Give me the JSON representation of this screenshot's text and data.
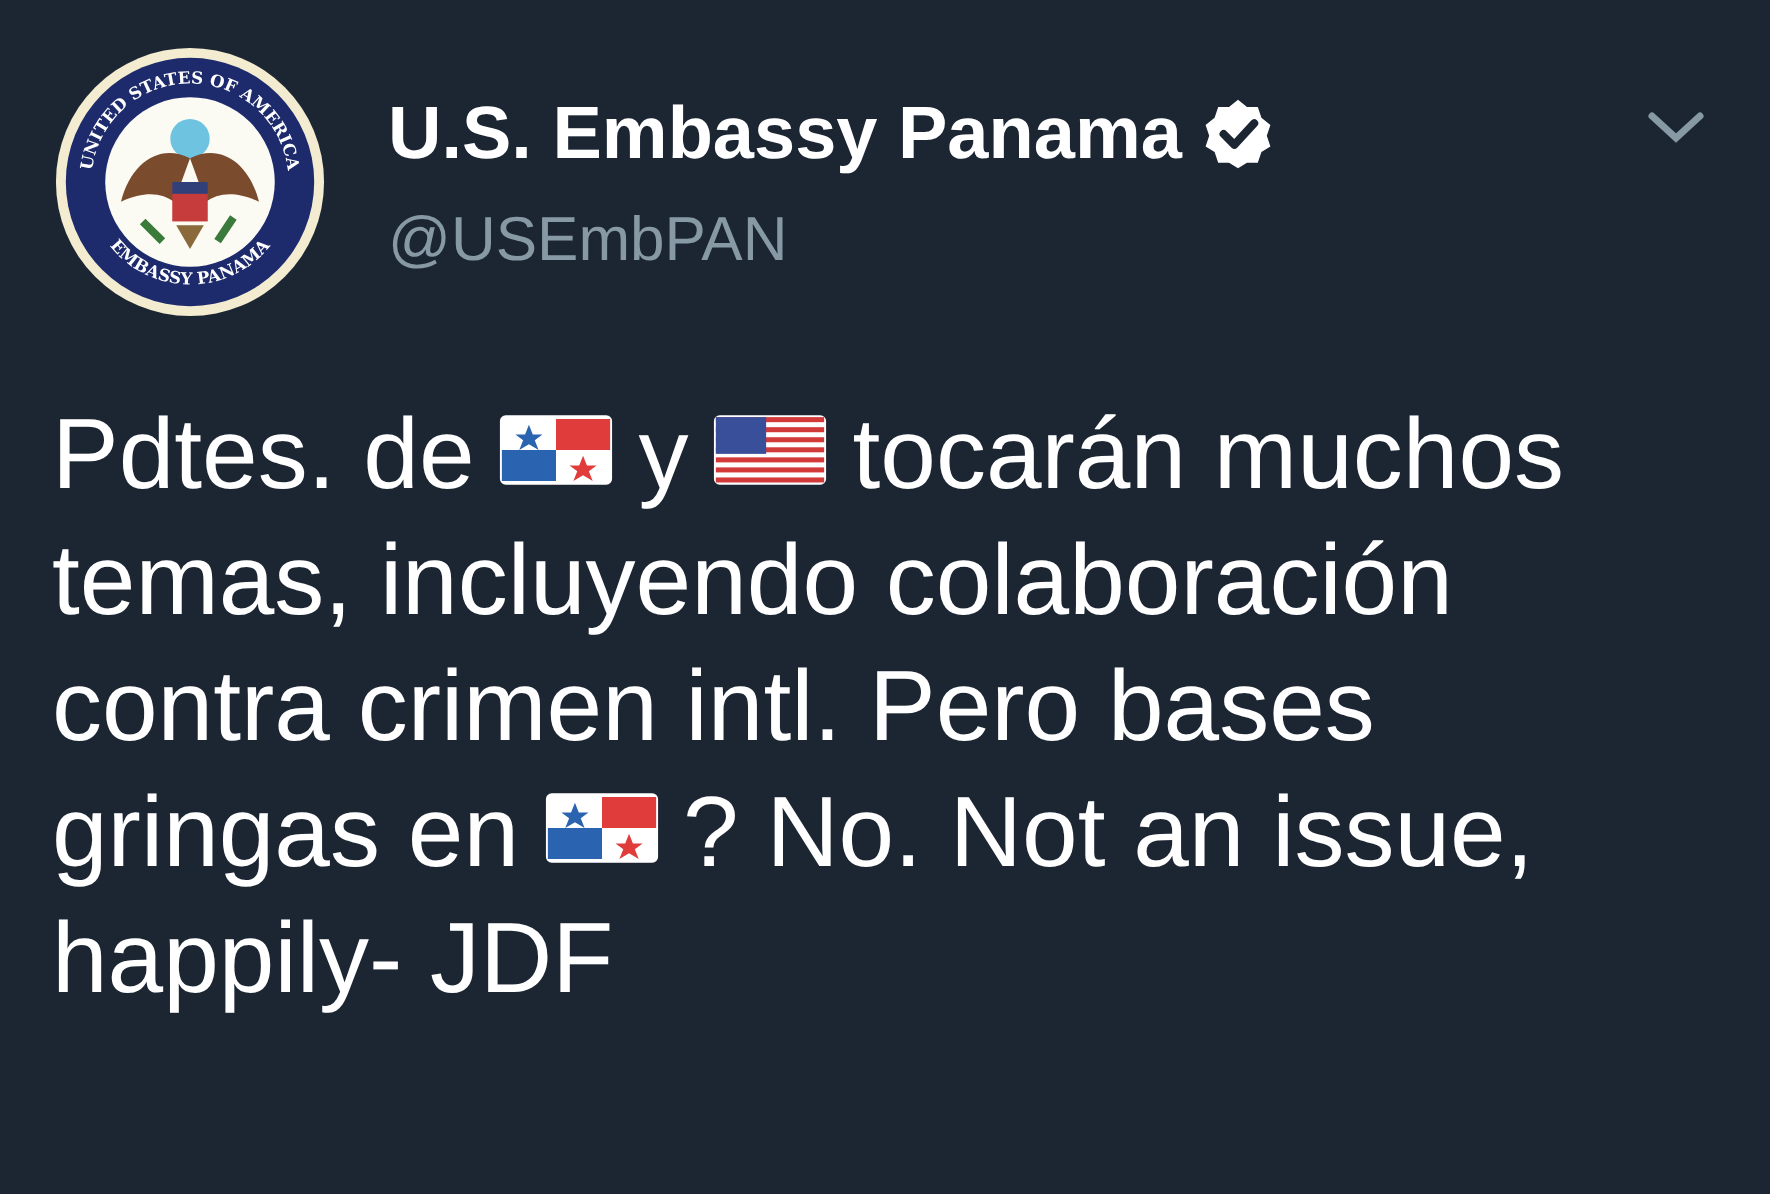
{
  "account": {
    "name": "U.S. Embassy Panama",
    "verified": true,
    "handle": "@USEmbPAN",
    "seal_top": "UNITED STATES OF AMERICA",
    "seal_bottom": "EMBASSY PANAMA"
  },
  "tweet_lines": [
    [
      {
        "kind": "text",
        "text": "Pdtes. de"
      },
      {
        "kind": "panama-flag"
      },
      {
        "kind": "text",
        "text": "y"
      },
      {
        "kind": "us-flag"
      },
      {
        "kind": "text",
        "text": "tocarán muchos"
      }
    ],
    [
      {
        "kind": "text",
        "text": "temas, incluyendo colaboración"
      }
    ],
    [
      {
        "kind": "text",
        "text": "contra crimen intl. Pero bases"
      }
    ],
    [
      {
        "kind": "text",
        "text": "gringas en"
      },
      {
        "kind": "panama-flag"
      },
      {
        "kind": "text",
        "text": "? No. Not an issue,"
      }
    ],
    [
      {
        "kind": "text",
        "text": "happily- JDF"
      }
    ]
  ]
}
